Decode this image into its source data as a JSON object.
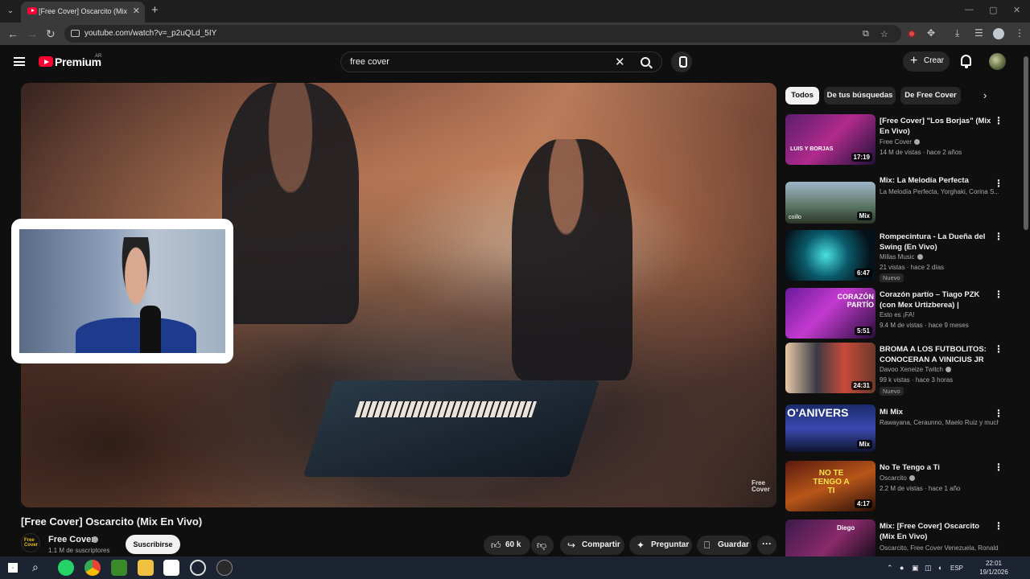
{
  "browser": {
    "tab_title": "[Free Cover] Oscarcito (Mix En Vivo)",
    "new_tab_icon": "+",
    "url": "youtube.com/watch?v=_p2uQLd_5IY",
    "window_controls": [
      "—",
      "▢",
      "✕"
    ]
  },
  "yt": {
    "brand": "Premium",
    "country": "AR",
    "search_value": "free cover",
    "create_label": "Crear"
  },
  "video": {
    "title": "[Free Cover] Oscarcito (Mix En Vivo)",
    "watermark": "Free Cover",
    "channel": "Free Cover",
    "channel_avatar_text": "Free Cover",
    "subscribers": "1.1 M de suscriptores",
    "subscribe_label": "Suscribirse",
    "likes": "60 k",
    "share_label": "Compartir",
    "ask_label": "Preguntar",
    "save_label": "Guardar"
  },
  "chips": [
    "Todos",
    "De tus búsquedas",
    "De Free Cover"
  ],
  "recommendations": [
    {
      "title": "[Free Cover] \"Los Borjas\" (Mix En Vivo)",
      "channel": "Free Cover",
      "meta": "14 M de vistas · hace 2 años",
      "duration": "17:19",
      "badge": ""
    },
    {
      "title": "Mix: La Melodía Perfecta",
      "channel": "La Melodía Perfecta, Yorghaki, Corina S...",
      "meta": "",
      "duration": "Mix",
      "badge": ""
    },
    {
      "title": "Rompecintura - La Dueña del Swing (En Vivo)",
      "channel": "Millas Music",
      "meta": "21 vistas · hace 2 días",
      "duration": "6:47",
      "badge": "Nuevo"
    },
    {
      "title": "Corazón partío – Tiago PZK (con Mex Urtizberea) | Sesione...",
      "channel": "Esto es ¡FA!",
      "meta": "9.4 M de vistas · hace 9 meses",
      "duration": "5:51",
      "badge": ""
    },
    {
      "title": "BROMA A LOS FUTBOLITOS: CONOCERAN A VINICIUS JR S...",
      "channel": "Davoo Xeneize Twitch",
      "meta": "99 k vistas · hace 3 horas",
      "duration": "24:31",
      "badge": "Nuevo"
    },
    {
      "title": "Mi Mix",
      "channel": "Rawayana, Ceraunno, Maelo Ruiz y much...",
      "meta": "",
      "duration": "Mix",
      "badge": ""
    },
    {
      "title": "No Te Tengo a Ti",
      "channel": "Oscarcito",
      "meta": "2.2 M de vistas · hace 1 año",
      "duration": "4:17",
      "badge": ""
    },
    {
      "title": "Mix: [Free Cover] Oscarcito (Mix En Vivo)",
      "channel": "Oscarcito, Free Cover Venezuela, Ronald ...",
      "meta": "",
      "duration": "",
      "badge": ""
    }
  ],
  "thumb_text": {
    "t1": "LUIS Y BORJAS",
    "t2": "coillo",
    "t4": "CORAZÓN PARTÍO",
    "t6": "O'ANIVERS",
    "t7": "NO TE TENGO A TI",
    "t8": "Diego"
  },
  "taskbar": {
    "lang": "ESP",
    "time": "22:01",
    "date": "19/1/2026"
  },
  "colors": {
    "accent_red": "#ff0033",
    "background": "#0f0f0f",
    "pill": "#272727"
  }
}
